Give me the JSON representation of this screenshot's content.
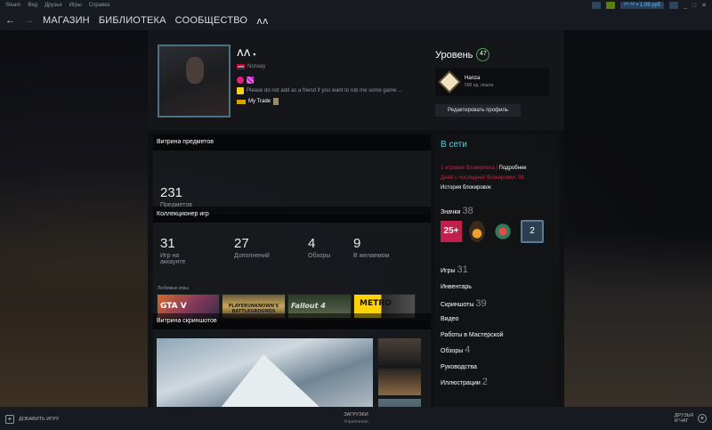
{
  "titlebar": {
    "menu": [
      "Steam",
      "Вид",
      "Друзья",
      "Игры",
      "Справка"
    ],
    "wallet": "⁹ᴬ ᴬᴬ • 1.09 руб",
    "window_controls": [
      "_",
      "□",
      "✕"
    ]
  },
  "navbar": {
    "back": "←",
    "forward": "→",
    "store": "МАГАЗИН",
    "library": "БИБЛИОТЕКА",
    "community": "СООБЩЕСТВО",
    "user": "ᴧᴧ"
  },
  "profile": {
    "username": "ᴧᴧ",
    "caret": "▾",
    "country": "Norway",
    "summary_text": "Please do not add as a friend if you want to rub me some game ...",
    "trade_text": "My Trade",
    "level_label": "Уровень",
    "level": "47",
    "fav_badge_name": "Hanza",
    "fav_badge_xp": "500 ед. опыта",
    "edit_button": "Редактировать профиль"
  },
  "items_showcase": {
    "title": "Витрина предметов",
    "count": "231",
    "label": "Предметов"
  },
  "game_collector": {
    "title": "Коллекционер игр",
    "stats": [
      {
        "value": "31",
        "label": "Игр на аккаунте"
      },
      {
        "value": "27",
        "label": "Дополнений"
      },
      {
        "value": "4",
        "label": "Обзоры"
      },
      {
        "value": "9",
        "label": "В желаемом"
      }
    ],
    "favorites_label": "Любимые игры",
    "favorites": [
      {
        "label": "GTA V"
      },
      {
        "label": "PLAYERUNKNOWN'S BATTLEGROUNDS"
      },
      {
        "label": "Fallout 4"
      },
      {
        "label": "METRO"
      }
    ]
  },
  "screenshots": {
    "title": "Витрина скриншотов"
  },
  "status": {
    "online": "В сети",
    "ban_line": "1 игровая блокировка",
    "ban_more": "Подробнее",
    "ban_days": "Дней с последней блокировки: 98",
    "ban_history": "История блокировок"
  },
  "links": [
    {
      "label": "Значки",
      "count": "38"
    },
    {
      "label": "Игры",
      "count": "31"
    },
    {
      "label": "Инвентарь",
      "count": ""
    },
    {
      "label": "Скриншоты",
      "count": "39"
    },
    {
      "label": "Видео",
      "count": ""
    },
    {
      "label": "Работы в Мастерской",
      "count": ""
    },
    {
      "label": "Обзоры",
      "count": "4"
    },
    {
      "label": "Руководства",
      "count": ""
    },
    {
      "label": "Иллюстрации",
      "count": "2"
    }
  ],
  "badges": {
    "b1": "25+",
    "b4": "2"
  },
  "bottombar": {
    "add_game": "ДОБАВИТЬ ИГРУ",
    "downloads": "ЗАГРУЗКИ",
    "downloads_sub": "Управление",
    "friends": "ДРУЗЬЯ\nИ ЧАТ"
  }
}
